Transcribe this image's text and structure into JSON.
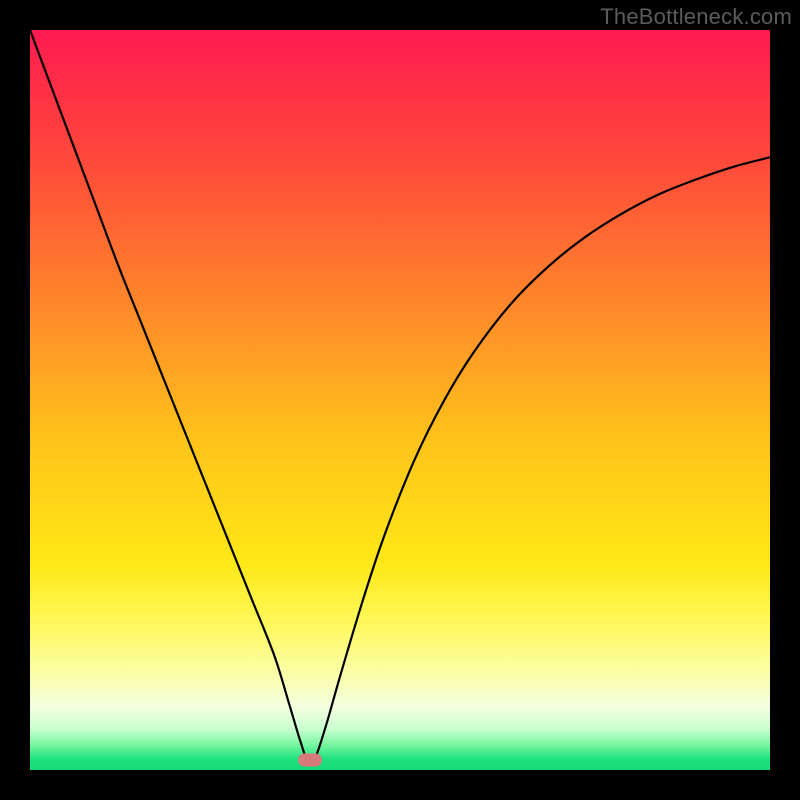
{
  "watermark": "TheBottleneck.com",
  "chart_data": {
    "type": "line",
    "title": "",
    "xlabel": "",
    "ylabel": "",
    "xlim": [
      0,
      100
    ],
    "ylim": [
      0,
      100
    ],
    "background_gradient": {
      "direction": "vertical",
      "stops": [
        {
          "pos": 0.0,
          "color": "#ff1a50"
        },
        {
          "pos": 0.18,
          "color": "#ff4a3a"
        },
        {
          "pos": 0.38,
          "color": "#ff8a2a"
        },
        {
          "pos": 0.55,
          "color": "#ffc21a"
        },
        {
          "pos": 0.72,
          "color": "#ffe816"
        },
        {
          "pos": 0.8,
          "color": "#fff85a"
        },
        {
          "pos": 0.87,
          "color": "#fbffa8"
        },
        {
          "pos": 0.915,
          "color": "#f4ffe0"
        },
        {
          "pos": 0.945,
          "color": "#c8ffce"
        },
        {
          "pos": 0.965,
          "color": "#7cf7a2"
        },
        {
          "pos": 0.985,
          "color": "#1fe27e"
        },
        {
          "pos": 1.0,
          "color": "#17d877"
        }
      ]
    },
    "series": [
      {
        "name": "bottleneck-curve",
        "color": "#000000",
        "thickness": 2.2,
        "x": [
          0,
          3,
          6,
          9,
          12,
          15,
          18,
          21,
          24,
          27,
          30,
          33,
          35,
          36.5,
          37.6,
          38.5,
          40,
          42,
          45,
          48,
          52,
          56,
          60,
          65,
          70,
          75,
          80,
          85,
          90,
          95,
          100
        ],
        "y": [
          100,
          92,
          84,
          76,
          68,
          60.5,
          53,
          45.5,
          38,
          30.5,
          23,
          15.5,
          9,
          4,
          1,
          1.5,
          6,
          13,
          23,
          32,
          42,
          50,
          56.5,
          63,
          68,
          72,
          75.2,
          77.8,
          79.8,
          81.5,
          82.8
        ]
      }
    ],
    "marker": {
      "x": 37.8,
      "y": 1.4,
      "color": "#d67a7c"
    },
    "grid": false,
    "legend": false
  }
}
